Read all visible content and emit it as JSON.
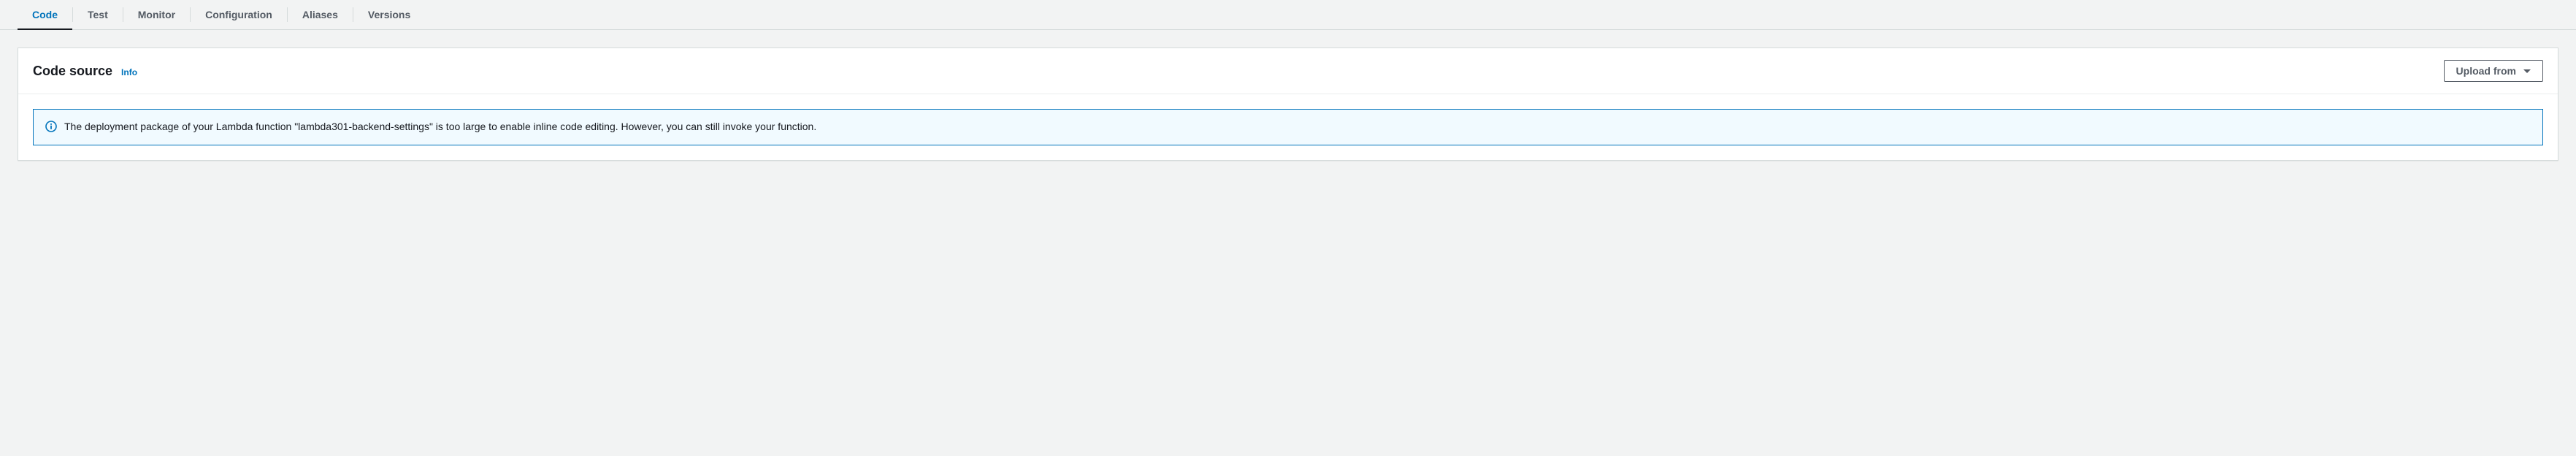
{
  "tabs": {
    "items": [
      {
        "label": "Code",
        "active": true
      },
      {
        "label": "Test",
        "active": false
      },
      {
        "label": "Monitor",
        "active": false
      },
      {
        "label": "Configuration",
        "active": false
      },
      {
        "label": "Aliases",
        "active": false
      },
      {
        "label": "Versions",
        "active": false
      }
    ]
  },
  "panel": {
    "title": "Code source",
    "info_label": "Info",
    "upload_label": "Upload from"
  },
  "alert": {
    "message": "The deployment package of your Lambda function \"lambda301-backend-settings\" is too large to enable inline code editing. However, you can still invoke your function."
  }
}
